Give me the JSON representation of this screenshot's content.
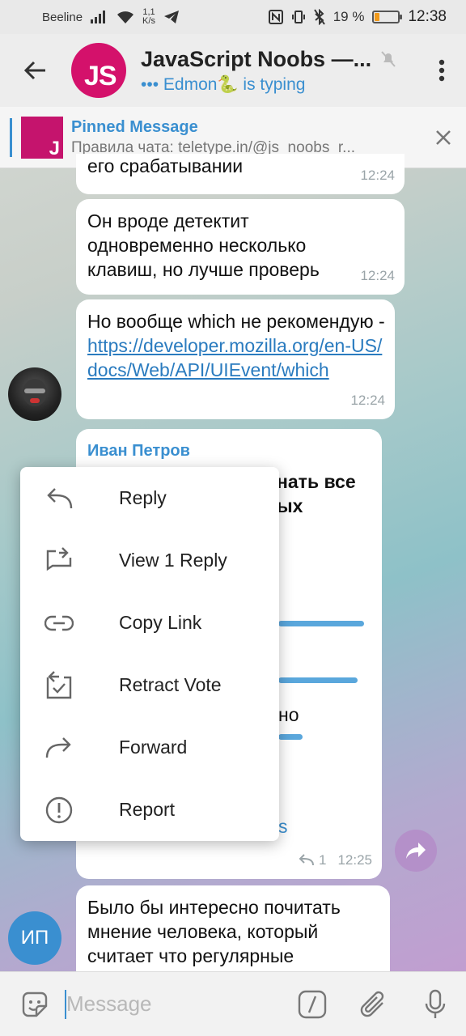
{
  "status_bar": {
    "carrier": "Beeline",
    "speed_value": "1,1",
    "speed_unit": "K/s",
    "battery_percent": "19 %",
    "battery_level": 0.19,
    "time": "12:38"
  },
  "header": {
    "avatar_text": "JS",
    "title": "JavaScript Noobs —...",
    "status": "••• Edmon🐍 is typing"
  },
  "pinned": {
    "title": "Pinned Message",
    "thumb_text": "J",
    "body": "Правила чата: teletype.in/@js_noobs_r..."
  },
  "messages": [
    {
      "text": "его срабатывании",
      "time": "12:24"
    },
    {
      "text": "Он вроде детектит одновременно несколько клавиш, но лучше проверь",
      "time": "12:24"
    },
    {
      "text_prefix": "Но вообще which не рекомендую - ",
      "link": "https://developer.mozilla.org/en-US/docs/Web/API/UIEvent/which",
      "time": "12:24"
    },
    {
      "sender": "Иван Петров",
      "visible_fragment_1": "нать все",
      "visible_fragment_2": "ых",
      "visible_fragment_3": "но",
      "visible_fragment_4": "s",
      "reply_count": "1",
      "time": "12:25"
    },
    {
      "text": "Было бы интересно почитать мнение человека, который считает что регулярные"
    }
  ],
  "avatar_initials": "ИП",
  "context_menu": [
    {
      "label": "Reply",
      "icon": "reply-icon"
    },
    {
      "label": "View 1 Reply",
      "icon": "view-replies-icon"
    },
    {
      "label": "Copy Link",
      "icon": "link-icon"
    },
    {
      "label": "Retract Vote",
      "icon": "retract-vote-icon"
    },
    {
      "label": "Forward",
      "icon": "forward-icon"
    },
    {
      "label": "Report",
      "icon": "report-icon"
    }
  ],
  "input": {
    "placeholder": "Message"
  },
  "colors": {
    "accent": "#3a8fd0",
    "brand_js": "#d4116b"
  }
}
